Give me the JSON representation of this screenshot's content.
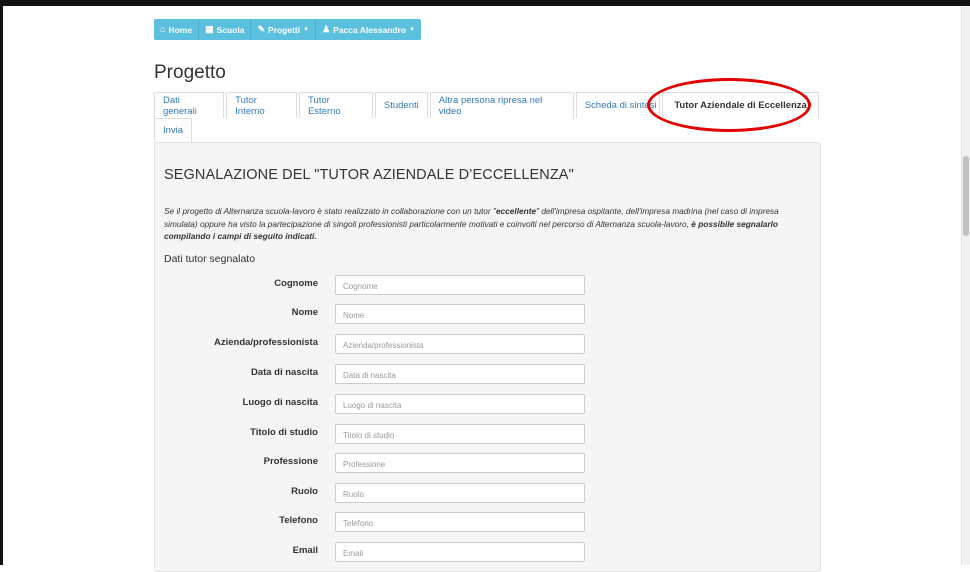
{
  "nav": {
    "items": [
      {
        "label": "Home",
        "icon": "home-icon",
        "glyph": "🏠",
        "has_caret": false
      },
      {
        "label": "Scuola",
        "icon": "building-icon",
        "glyph": "▦",
        "has_caret": false
      },
      {
        "label": "Progetti",
        "icon": "pencil-icon",
        "glyph": "✎",
        "has_caret": true
      },
      {
        "label": "Pacca Alessandro",
        "icon": "user-icon",
        "glyph": "👤",
        "has_caret": true
      }
    ],
    "color": "#5bc0de"
  },
  "page_title": "Progetto",
  "tabs": {
    "row1": [
      {
        "label": "Dati generali",
        "active": false
      },
      {
        "label": "Tutor Interno",
        "active": false
      },
      {
        "label": "Tutor Esterno",
        "active": false
      },
      {
        "label": "Studenti",
        "active": false
      },
      {
        "label": "Altra persona ripresa nel video",
        "active": false
      },
      {
        "label": "Scheda di sintesi",
        "active": false
      },
      {
        "label": "Tutor Aziendale di Eccellenza",
        "active": true
      }
    ],
    "row2": [
      {
        "label": "Invia",
        "active": false
      }
    ],
    "link_color": "#337ab7"
  },
  "highlight_color": "#e30000",
  "section": {
    "heading": "SEGNALAZIONE DEL \"TUTOR AZIENDALE D’ECCELLENZA\"",
    "intro_1": "Se il progetto di Alternanza scuola-lavoro è stato realizzato in collaborazione con un tutor \"",
    "intro_bold_1": "eccellente",
    "intro_2": "\" dell'impresa ospitante, dell'impresa madrina (nel caso di impresa simulata) oppure ha visto la partecipazione di singoli professionisti particolarmente motivati e coinvolti nel percorso di Alternanza scuola-lavoro, ",
    "intro_bold_2": "è possibile segnalarlo compilando i campi di seguito indicati.",
    "subhead": "Dati tutor segnalato"
  },
  "form": {
    "fields": [
      {
        "label": "Cognome",
        "placeholder": "Cognome",
        "value": ""
      },
      {
        "label": "Nome",
        "placeholder": "Nome",
        "value": ""
      },
      {
        "label": "Azienda/professionista",
        "placeholder": "Azienda/professionista",
        "value": ""
      },
      {
        "label": "Data di nascita",
        "placeholder": "Data di nascita",
        "value": ""
      },
      {
        "label": "Luogo di nascita",
        "placeholder": "Luogo di nascita",
        "value": ""
      },
      {
        "label": "Titolo di studio",
        "placeholder": "Titolo di studio",
        "value": ""
      },
      {
        "label": "Professione",
        "placeholder": "Professione",
        "value": ""
      },
      {
        "label": "Ruolo",
        "placeholder": "Ruolo",
        "value": ""
      },
      {
        "label": "Telefono",
        "placeholder": "Telefono",
        "value": ""
      },
      {
        "label": "Email",
        "placeholder": "Email",
        "value": ""
      }
    ]
  }
}
